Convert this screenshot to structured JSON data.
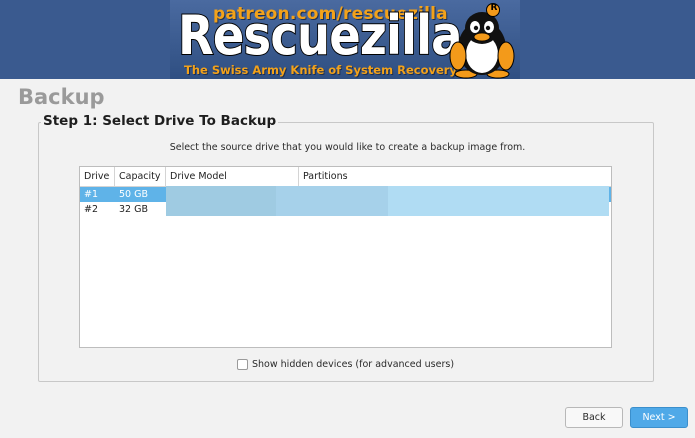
{
  "banner": {
    "patreon_text": "patreon.com/rescuezilla",
    "logo_text": "Rescuezilla",
    "tagline": "The Swiss Army Knife of System Recovery",
    "mascot_badge": "R",
    "accent_color": "#f3a21a",
    "background_color": "#3a5a8f"
  },
  "page": {
    "title": "Backup"
  },
  "step": {
    "title": "Step 1: Select Drive To Backup",
    "instruction": "Select the source drive that you would like to create a backup image from."
  },
  "drive_table": {
    "columns": [
      "Drive",
      "Capacity",
      "Drive Model",
      "Partitions"
    ],
    "rows": [
      {
        "drive": "#1",
        "capacity": "50 GB",
        "selected": true
      },
      {
        "drive": "#2",
        "capacity": "32 GB",
        "selected": false
      }
    ],
    "selection_color": "#5fb3e8"
  },
  "options": {
    "show_hidden_label": "Show hidden devices (for advanced users)",
    "show_hidden_checked": false
  },
  "buttons": {
    "back_label": "Back",
    "next_label": "Next >",
    "next_color": "#4fa9e8"
  }
}
